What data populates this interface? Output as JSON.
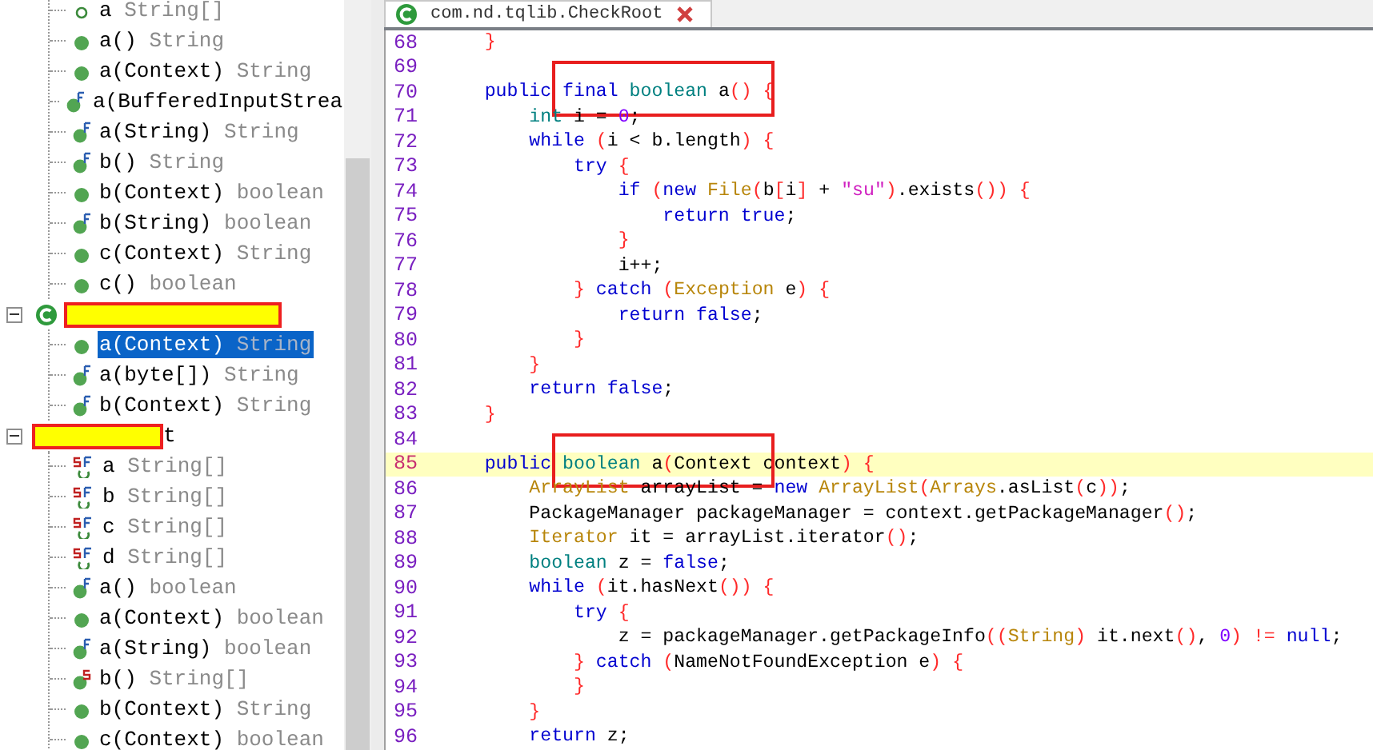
{
  "tree": [
    {
      "kind": "partial-class",
      "children": [
        {
          "kind": "field",
          "name": "a",
          "type": "String[]",
          "selected": false
        },
        {
          "kind": "method",
          "name": "a()",
          "type": "String",
          "selected": false
        },
        {
          "kind": "method",
          "name": "a(Context)",
          "type": "String",
          "selected": false
        },
        {
          "kind": "final-method",
          "name": "a(BufferedInputStrea",
          "selected": false
        },
        {
          "kind": "final-method",
          "name": "a(String)",
          "type": "String",
          "selected": false
        },
        {
          "kind": "final-method",
          "name": "b()",
          "type": "String",
          "selected": false
        },
        {
          "kind": "method",
          "name": "b(Context)",
          "type": "boolean",
          "selected": false
        },
        {
          "kind": "final-method",
          "name": "b(String)",
          "type": "boolean",
          "selected": false
        },
        {
          "kind": "method",
          "name": "c(Context)",
          "type": "String",
          "selected": false
        },
        {
          "kind": "method",
          "name": "c()",
          "type": "boolean",
          "selected": false
        }
      ]
    },
    {
      "kind": "class",
      "redacted": true,
      "expanded": true,
      "children": [
        {
          "kind": "method",
          "name": "a(Context)",
          "type": "String",
          "selected": true
        },
        {
          "kind": "final-method",
          "name": "a(byte[])",
          "type": "String",
          "selected": false
        },
        {
          "kind": "final-method",
          "name": "b(Context)",
          "type": "String",
          "selected": false
        }
      ]
    },
    {
      "kind": "class",
      "redacted": true,
      "name_tail": "t",
      "expanded": true,
      "children": [
        {
          "kind": "static-final-field",
          "name": "a",
          "type": "String[]",
          "selected": false
        },
        {
          "kind": "static-final-field",
          "name": "b",
          "type": "String[]",
          "selected": false
        },
        {
          "kind": "static-final-field",
          "name": "c",
          "type": "String[]",
          "selected": false
        },
        {
          "kind": "static-final-field",
          "name": "d",
          "type": "String[]",
          "selected": false
        },
        {
          "kind": "final-method",
          "name": "a()",
          "type": "boolean",
          "selected": false
        },
        {
          "kind": "method",
          "name": "a(Context)",
          "type": "boolean",
          "selected": false
        },
        {
          "kind": "final-method",
          "name": "a(String)",
          "type": "boolean",
          "selected": false
        },
        {
          "kind": "static-method",
          "name": "b()",
          "type": "String[]",
          "selected": false
        },
        {
          "kind": "method",
          "name": "b(Context)",
          "type": "String",
          "selected": false
        },
        {
          "kind": "method",
          "name": "c(Context)",
          "type": "boolean",
          "selected": false
        }
      ]
    }
  ],
  "editor_tab": {
    "title": "com.nd.tqlib.CheckRoot",
    "selected": true
  },
  "code": [
    {
      "number": "68",
      "tokens": [
        {
          "kind": "paren",
          "text": "    }"
        }
      ]
    },
    {
      "number": "69"
    },
    {
      "number": "70",
      "annotation_box": true,
      "tokens": [
        {
          "kind": "kw",
          "text": "    public final "
        },
        {
          "kind": "type",
          "text": "boolean"
        },
        {
          "kind": "plain",
          "text": " a"
        },
        {
          "kind": "paren",
          "text": "() {"
        }
      ]
    },
    {
      "number": "71",
      "tokens": [
        {
          "kind": "type",
          "text": "        int"
        },
        {
          "kind": "plain",
          "text": " i = "
        },
        {
          "kind": "num",
          "text": "0"
        },
        {
          "kind": "plain",
          "text": ";"
        }
      ]
    },
    {
      "number": "72",
      "tokens": [
        {
          "kind": "kw",
          "text": "        while "
        },
        {
          "kind": "paren",
          "text": "("
        },
        {
          "kind": "plain",
          "text": "i < b.length"
        },
        {
          "kind": "paren",
          "text": ") {"
        }
      ]
    },
    {
      "number": "73",
      "tokens": [
        {
          "kind": "kw",
          "text": "            try "
        },
        {
          "kind": "paren",
          "text": "{"
        }
      ]
    },
    {
      "number": "74",
      "tokens": [
        {
          "kind": "kw",
          "text": "                if "
        },
        {
          "kind": "paren",
          "text": "("
        },
        {
          "kind": "kw",
          "text": "new "
        },
        {
          "kind": "cls",
          "text": "File"
        },
        {
          "kind": "paren",
          "text": "("
        },
        {
          "kind": "plain",
          "text": "b"
        },
        {
          "kind": "paren",
          "text": "["
        },
        {
          "kind": "plain",
          "text": "i"
        },
        {
          "kind": "paren",
          "text": "]"
        },
        {
          "kind": "plain",
          "text": " + "
        },
        {
          "kind": "str",
          "text": "\"su\""
        },
        {
          "kind": "paren",
          "text": ")"
        },
        {
          "kind": "plain",
          "text": ".exists"
        },
        {
          "kind": "paren",
          "text": "()) {"
        }
      ]
    },
    {
      "number": "75",
      "tokens": [
        {
          "kind": "kw",
          "text": "                    return true"
        },
        {
          "kind": "plain",
          "text": ";"
        }
      ]
    },
    {
      "number": "76",
      "tokens": [
        {
          "kind": "paren",
          "text": "                }"
        }
      ]
    },
    {
      "number": "77",
      "tokens": [
        {
          "kind": "plain",
          "text": "                i++;"
        }
      ]
    },
    {
      "number": "78",
      "tokens": [
        {
          "kind": "paren",
          "text": "            } "
        },
        {
          "kind": "kw",
          "text": "catch "
        },
        {
          "kind": "paren",
          "text": "("
        },
        {
          "kind": "cls",
          "text": "Exception"
        },
        {
          "kind": "plain",
          "text": " e"
        },
        {
          "kind": "paren",
          "text": ") {"
        }
      ]
    },
    {
      "number": "79",
      "tokens": [
        {
          "kind": "kw",
          "text": "                return false"
        },
        {
          "kind": "plain",
          "text": ";"
        }
      ]
    },
    {
      "number": "80",
      "tokens": [
        {
          "kind": "paren",
          "text": "            }"
        }
      ]
    },
    {
      "number": "81",
      "tokens": [
        {
          "kind": "paren",
          "text": "        }"
        }
      ]
    },
    {
      "number": "82",
      "tokens": [
        {
          "kind": "kw",
          "text": "        return false"
        },
        {
          "kind": "plain",
          "text": ";"
        }
      ]
    },
    {
      "number": "83",
      "tokens": [
        {
          "kind": "paren",
          "text": "    }"
        }
      ]
    },
    {
      "number": "84"
    },
    {
      "number": "85",
      "current": true,
      "annotation_box": true,
      "tokens": [
        {
          "kind": "kw",
          "text": "    public "
        },
        {
          "kind": "type",
          "text": "boolean"
        },
        {
          "kind": "plain",
          "text": " a"
        },
        {
          "kind": "paren",
          "text": "("
        },
        {
          "kind": "plain",
          "text": "Context context"
        },
        {
          "kind": "paren",
          "text": ") {"
        }
      ]
    },
    {
      "number": "86",
      "tokens": [
        {
          "kind": "cls",
          "text": "        ArrayList"
        },
        {
          "kind": "plain",
          "text": " arrayList = "
        },
        {
          "kind": "kw",
          "text": "new "
        },
        {
          "kind": "cls",
          "text": "ArrayList"
        },
        {
          "kind": "paren",
          "text": "("
        },
        {
          "kind": "cls",
          "text": "Arrays"
        },
        {
          "kind": "plain",
          "text": ".asList"
        },
        {
          "kind": "paren",
          "text": "("
        },
        {
          "kind": "plain",
          "text": "c"
        },
        {
          "kind": "paren",
          "text": "))"
        },
        {
          "kind": "plain",
          "text": ";"
        }
      ]
    },
    {
      "number": "87",
      "tokens": [
        {
          "kind": "plain",
          "text": "        PackageManager packageManager = context.getPackageManager"
        },
        {
          "kind": "paren",
          "text": "()"
        },
        {
          "kind": "plain",
          "text": ";"
        }
      ]
    },
    {
      "number": "88",
      "tokens": [
        {
          "kind": "cls",
          "text": "        Iterator"
        },
        {
          "kind": "plain",
          "text": " it = arrayList.iterator"
        },
        {
          "kind": "paren",
          "text": "()"
        },
        {
          "kind": "plain",
          "text": ";"
        }
      ]
    },
    {
      "number": "89",
      "tokens": [
        {
          "kind": "type",
          "text": "        boolean"
        },
        {
          "kind": "plain",
          "text": " z = "
        },
        {
          "kind": "kw",
          "text": "false"
        },
        {
          "kind": "plain",
          "text": ";"
        }
      ]
    },
    {
      "number": "90",
      "tokens": [
        {
          "kind": "kw",
          "text": "        while "
        },
        {
          "kind": "paren",
          "text": "("
        },
        {
          "kind": "plain",
          "text": "it.hasNext"
        },
        {
          "kind": "paren",
          "text": "()) {"
        }
      ]
    },
    {
      "number": "91",
      "tokens": [
        {
          "kind": "kw",
          "text": "            try "
        },
        {
          "kind": "paren",
          "text": "{"
        }
      ]
    },
    {
      "number": "92",
      "tokens": [
        {
          "kind": "plain",
          "text": "                z = packageManager.getPackageInfo"
        },
        {
          "kind": "paren",
          "text": "(("
        },
        {
          "kind": "cls",
          "text": "String"
        },
        {
          "kind": "paren",
          "text": ")"
        },
        {
          "kind": "plain",
          "text": " it.next"
        },
        {
          "kind": "paren",
          "text": "()"
        },
        {
          "kind": "plain",
          "text": ", "
        },
        {
          "kind": "num",
          "text": "0"
        },
        {
          "kind": "paren",
          "text": ") !="
        },
        {
          "kind": "kw",
          "text": " null"
        },
        {
          "kind": "plain",
          "text": ";"
        }
      ]
    },
    {
      "number": "93",
      "tokens": [
        {
          "kind": "paren",
          "text": "            } "
        },
        {
          "kind": "kw",
          "text": "catch "
        },
        {
          "kind": "paren",
          "text": "("
        },
        {
          "kind": "plain",
          "text": "NameNotFoundException e"
        },
        {
          "kind": "paren",
          "text": ") {"
        }
      ]
    },
    {
      "number": "94",
      "tokens": [
        {
          "kind": "paren",
          "text": "            }"
        }
      ]
    },
    {
      "number": "95",
      "tokens": [
        {
          "kind": "paren",
          "text": "        }"
        }
      ]
    },
    {
      "number": "96",
      "tokens": [
        {
          "kind": "kw",
          "text": "        return"
        },
        {
          "kind": "plain",
          "text": " z;"
        }
      ]
    }
  ]
}
